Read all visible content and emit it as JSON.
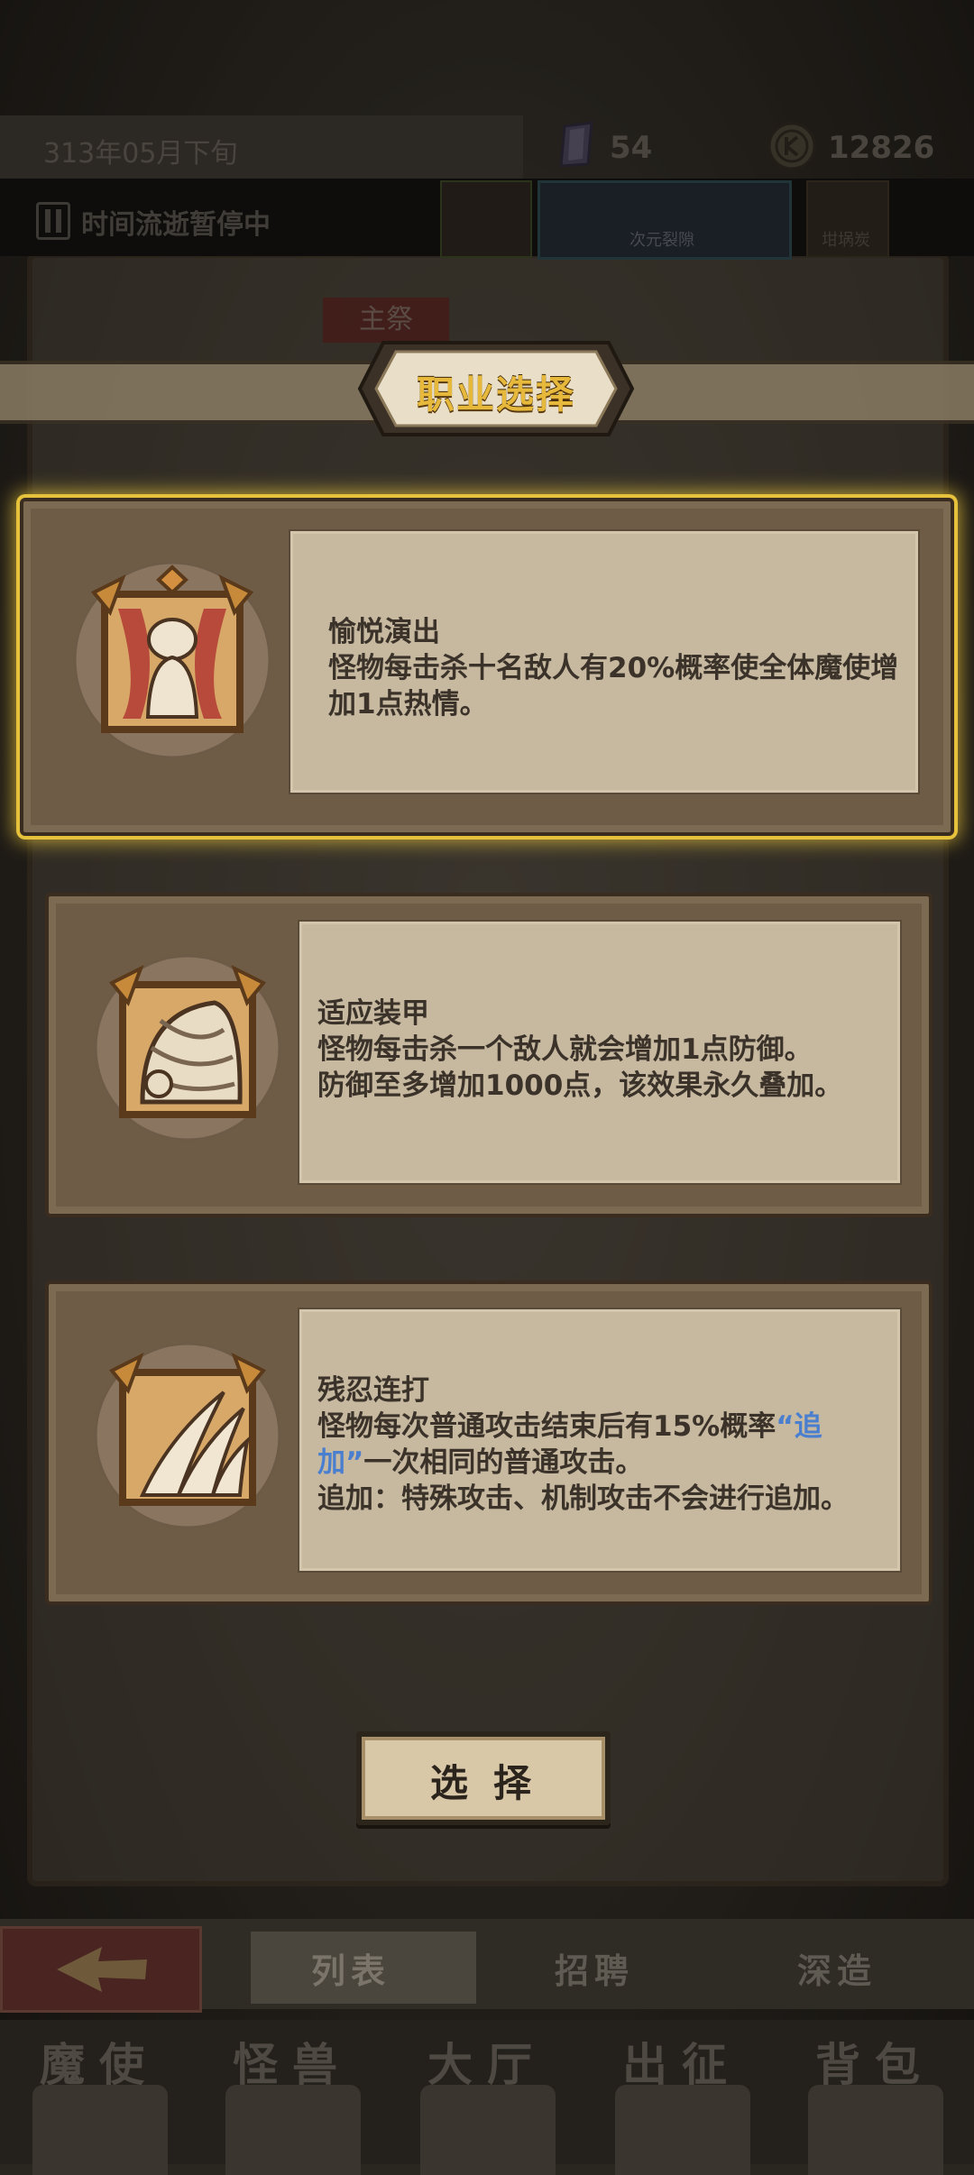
{
  "header": {
    "date": "313年05月下旬",
    "gems": "54",
    "coins": "12826",
    "time_status": "时间流逝暂停中",
    "tile_rift_label": "次元裂隙",
    "tile_right_label": "坩埚炭"
  },
  "background": {
    "tag": "主祭"
  },
  "dialog": {
    "title": "职业选择",
    "options": [
      {
        "title": "愉悦演出",
        "description": "怪物每击杀十名敌人有20%概率使全体魔使增加1点热情。",
        "icon": "performer-icon",
        "selected": true
      },
      {
        "title": "适应装甲",
        "description_lines": [
          "怪物每击杀一个敌人就会增加1点防御。",
          "防御至多增加1000点，该效果永久叠加。"
        ],
        "icon": "armor-helmet-icon",
        "selected": false
      },
      {
        "title": "残忍连打",
        "description_pre": "怪物每次普通攻击结束后有15%概率",
        "keyword": "“追加”",
        "description_post": "一次相同的普通攻击。",
        "note": "追加：特殊攻击、机制攻击不会进行追加。",
        "icon": "claw-strike-icon",
        "selected": false
      }
    ],
    "select_label": "选择"
  },
  "sub_nav": {
    "tabs": [
      "列表",
      "招聘",
      "深造"
    ],
    "active": "列表"
  },
  "main_nav": {
    "tabs": [
      "魔使",
      "怪兽",
      "大厅",
      "出征",
      "背包"
    ]
  },
  "colors": {
    "highlight": "#e5c13c",
    "title_gold": "#e6b93d",
    "keyword_blue": "#4a7fd0"
  }
}
